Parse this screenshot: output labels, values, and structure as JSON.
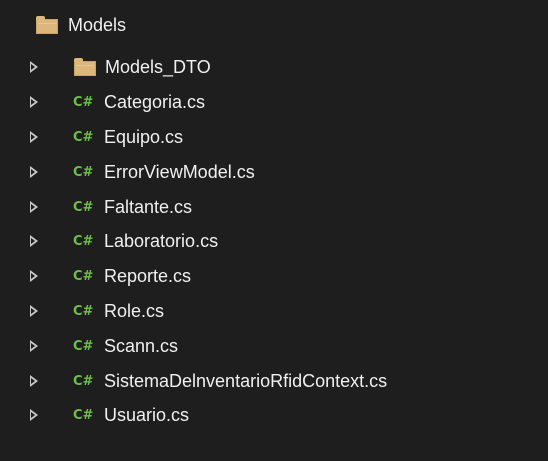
{
  "solution_explorer": {
    "root_folder": {
      "label": "Models",
      "icon": "folder-icon",
      "expanded": true
    },
    "items": [
      {
        "label": "Models_DTO",
        "icon": "folder-icon",
        "collapsed": true
      },
      {
        "label": "Categoria.cs",
        "icon": "csharp-file-icon",
        "badge": "C#",
        "collapsed": true
      },
      {
        "label": "Equipo.cs",
        "icon": "csharp-file-icon",
        "badge": "C#",
        "collapsed": true
      },
      {
        "label": "ErrorViewModel.cs",
        "icon": "csharp-file-icon",
        "badge": "C#",
        "collapsed": true
      },
      {
        "label": "Faltante.cs",
        "icon": "csharp-file-icon",
        "badge": "C#",
        "collapsed": true
      },
      {
        "label": "Laboratorio.cs",
        "icon": "csharp-file-icon",
        "badge": "C#",
        "collapsed": true
      },
      {
        "label": "Reporte.cs",
        "icon": "csharp-file-icon",
        "badge": "C#",
        "collapsed": true
      },
      {
        "label": "Role.cs",
        "icon": "csharp-file-icon",
        "badge": "C#",
        "collapsed": true
      },
      {
        "label": "Scann.cs",
        "icon": "csharp-file-icon",
        "badge": "C#",
        "collapsed": true
      },
      {
        "label": "SistemaDelnventarioRfidContext.cs",
        "icon": "csharp-file-icon",
        "badge": "C#",
        "collapsed": true
      },
      {
        "label": "Usuario.cs",
        "icon": "csharp-file-icon",
        "badge": "C#",
        "collapsed": true
      }
    ],
    "colors": {
      "background": "#1e1e1e",
      "text": "#f0f0f0",
      "folder": "#dcb67a",
      "csharp_badge": "#6cc04a",
      "expander": "#c8c8c8"
    }
  }
}
